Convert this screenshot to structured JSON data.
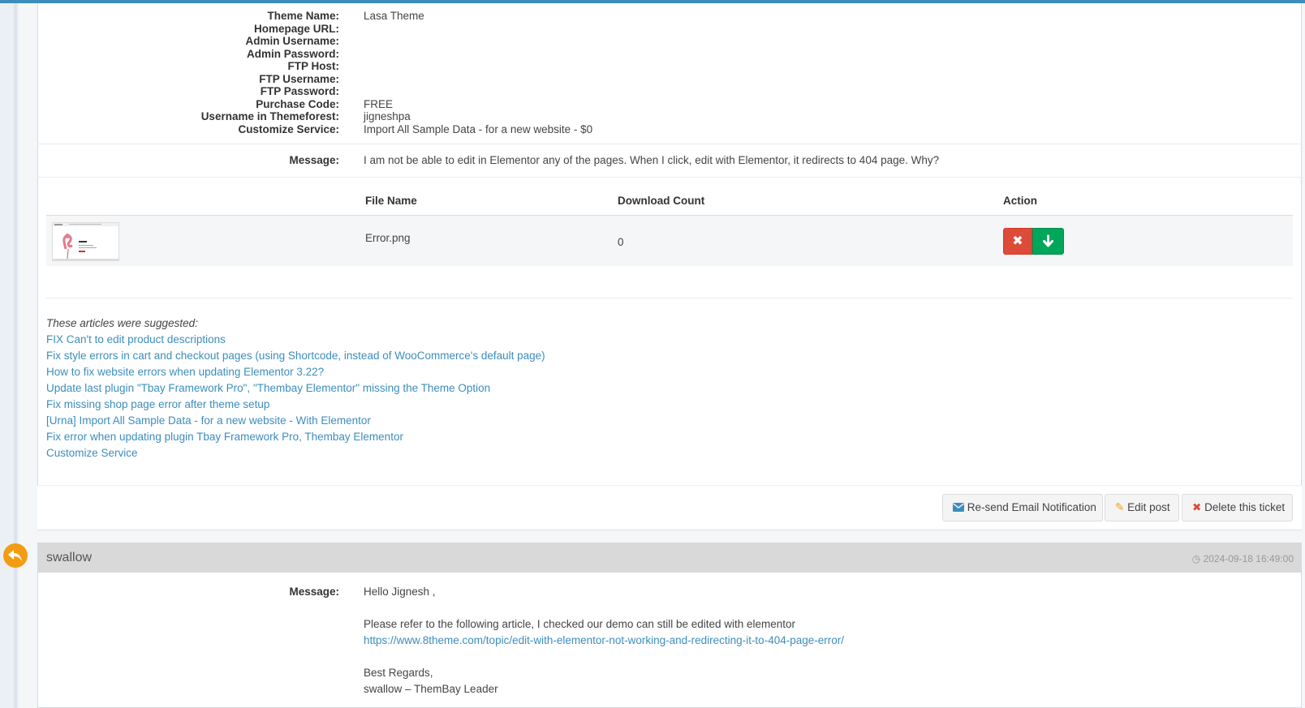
{
  "ticket": {
    "fields": [
      {
        "label": "Theme Name:",
        "value": "Lasa Theme"
      },
      {
        "label": "Homepage URL:",
        "value": ""
      },
      {
        "label": "Admin Username:",
        "value": ""
      },
      {
        "label": "Admin Password:",
        "value": ""
      },
      {
        "label": "FTP Host:",
        "value": ""
      },
      {
        "label": "FTP Username:",
        "value": ""
      },
      {
        "label": "FTP Password:",
        "value": ""
      },
      {
        "label": "Purchase Code:",
        "value": "FREE"
      },
      {
        "label": "Username in Themeforest:",
        "value": "jigneshpa"
      },
      {
        "label": "Customize Service:",
        "value": "Import All Sample Data - for a new website - $0"
      }
    ],
    "message_label": "Message:",
    "message": "I am not be able to edit in Elementor any of the pages. When I click, edit with Elementor, it redirects to 404 page. Why?"
  },
  "files": {
    "headers": {
      "file_name": "File Name",
      "download_count": "Download Count",
      "action": "Action"
    },
    "rows": [
      {
        "file_name": "Error.png",
        "download_count": "0"
      }
    ]
  },
  "suggestions": {
    "title": "These articles were suggested:",
    "links": [
      "FIX Can't to edit product descriptions",
      "Fix style errors in cart and checkout pages (using Shortcode, instead of WooCommerce's default page)",
      "How to fix website errors when updating Elementor 3.22?",
      "Update last plugin \"Tbay Framework Pro\", \"Thembay Elementor\" missing the Theme Option",
      "Fix missing shop page error after theme setup",
      "[Urna] Import All Sample Data - for a new website - With Elementor",
      "Fix error when updating plugin Tbay Framework Pro, Thembay Elementor",
      "Customize Service"
    ]
  },
  "actions": {
    "resend": "Re-send Email Notification",
    "edit": "Edit post",
    "delete": "Delete this ticket"
  },
  "reply": {
    "user": "swallow",
    "timestamp": "2024-09-18 16:49:00",
    "message_label": "Message:",
    "lines": [
      "Hello Jignesh ,",
      "Please refer to the following article, I checked our demo can still be edited with elementor",
      "https://www.8theme.com/topic/edit-with-elementor-not-working-and-redirecting-it-to-404-page-error/",
      "Best Regards,",
      "swallow – ThemBay Leader"
    ]
  },
  "colors": {
    "accent": "#3c8dbc",
    "danger": "#dd4b39",
    "success": "#00a65a",
    "reply_badge": "#f39c12"
  }
}
